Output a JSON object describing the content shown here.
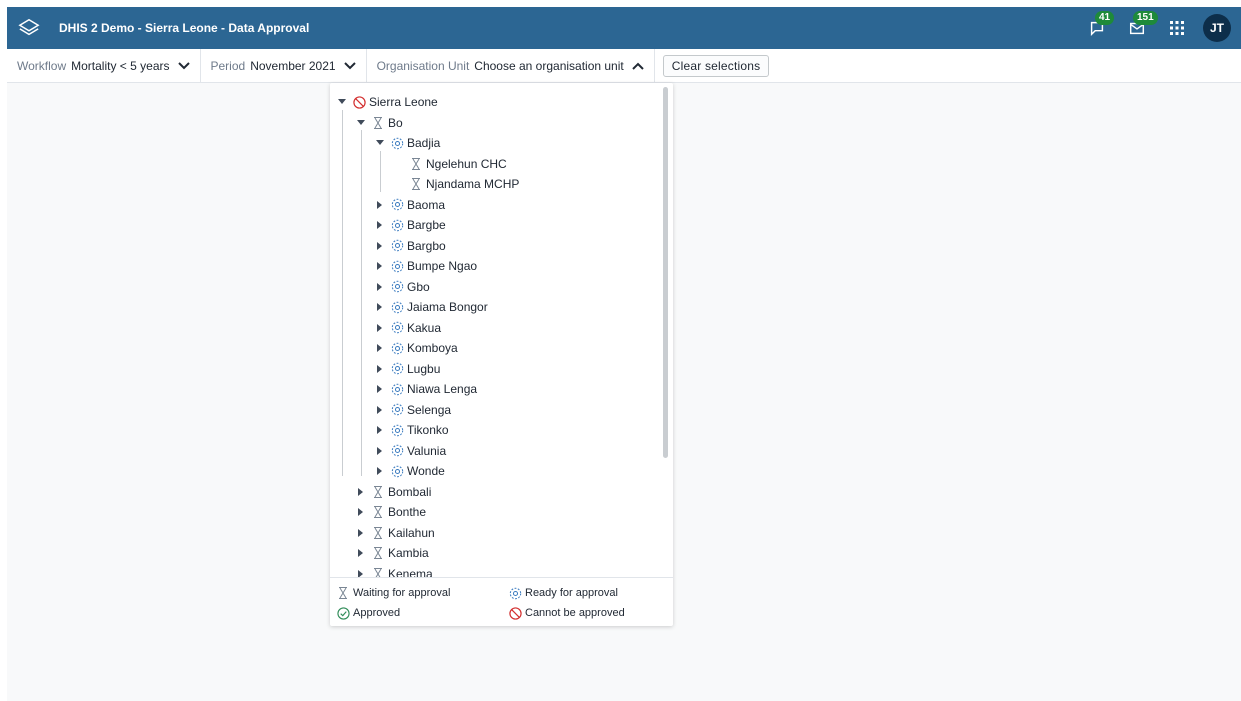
{
  "header": {
    "title": "DHIS 2 Demo - Sierra Leone - Data Approval",
    "interpretations_count": "41",
    "messages_count": "151",
    "user_initials": "JT"
  },
  "topbar": {
    "workflow_label": "Workflow",
    "workflow_value": "Mortality < 5 years",
    "period_label": "Period",
    "period_value": "November 2021",
    "orgunit_label": "Organisation Unit",
    "orgunit_value": "Choose an organisation unit",
    "clear_label": "Clear selections"
  },
  "tree": {
    "nodes": [
      {
        "label": "Sierra Leone",
        "status": "cannot-approve-icon",
        "arrow": "expanded"
      },
      {
        "label": "Bo",
        "status": "waiting-icon",
        "arrow": "expanded"
      },
      {
        "label": "Badjia",
        "status": "ready-icon",
        "arrow": "expanded"
      },
      {
        "label": "Ngelehun CHC",
        "status": "waiting-icon",
        "arrow": "none"
      },
      {
        "label": "Njandama MCHP",
        "status": "waiting-icon",
        "arrow": "none"
      },
      {
        "label": "Baoma",
        "status": "ready-icon",
        "arrow": "collapsed"
      },
      {
        "label": "Bargbe",
        "status": "ready-icon",
        "arrow": "collapsed"
      },
      {
        "label": "Bargbo",
        "status": "ready-icon",
        "arrow": "collapsed"
      },
      {
        "label": "Bumpe Ngao",
        "status": "ready-icon",
        "arrow": "collapsed"
      },
      {
        "label": "Gbo",
        "status": "ready-icon",
        "arrow": "collapsed"
      },
      {
        "label": "Jaiama Bongor",
        "status": "ready-icon",
        "arrow": "collapsed"
      },
      {
        "label": "Kakua",
        "status": "ready-icon",
        "arrow": "collapsed"
      },
      {
        "label": "Komboya",
        "status": "ready-icon",
        "arrow": "collapsed"
      },
      {
        "label": "Lugbu",
        "status": "ready-icon",
        "arrow": "collapsed"
      },
      {
        "label": "Niawa Lenga",
        "status": "ready-icon",
        "arrow": "collapsed"
      },
      {
        "label": "Selenga",
        "status": "ready-icon",
        "arrow": "collapsed"
      },
      {
        "label": "Tikonko",
        "status": "ready-icon",
        "arrow": "collapsed"
      },
      {
        "label": "Valunia",
        "status": "ready-icon",
        "arrow": "collapsed"
      },
      {
        "label": "Wonde",
        "status": "ready-icon",
        "arrow": "collapsed"
      },
      {
        "label": "Bombali",
        "status": "waiting-icon",
        "arrow": "collapsed"
      },
      {
        "label": "Bonthe",
        "status": "waiting-icon",
        "arrow": "collapsed"
      },
      {
        "label": "Kailahun",
        "status": "waiting-icon",
        "arrow": "collapsed"
      },
      {
        "label": "Kambia",
        "status": "waiting-icon",
        "arrow": "collapsed"
      },
      {
        "label": "Kenema",
        "status": "waiting-icon",
        "arrow": "collapsed"
      }
    ]
  },
  "legend": {
    "waiting": "Waiting for approval",
    "ready": "Ready for approval",
    "approved": "Approved",
    "cannot": "Cannot be approved"
  },
  "colors": {
    "header_bg": "#2c6693",
    "badge": "#1e8a3a",
    "ready": "#3b7bbf",
    "approved": "#2e8b57",
    "cannot": "#d32f2f",
    "waiting": "#7a8694"
  }
}
